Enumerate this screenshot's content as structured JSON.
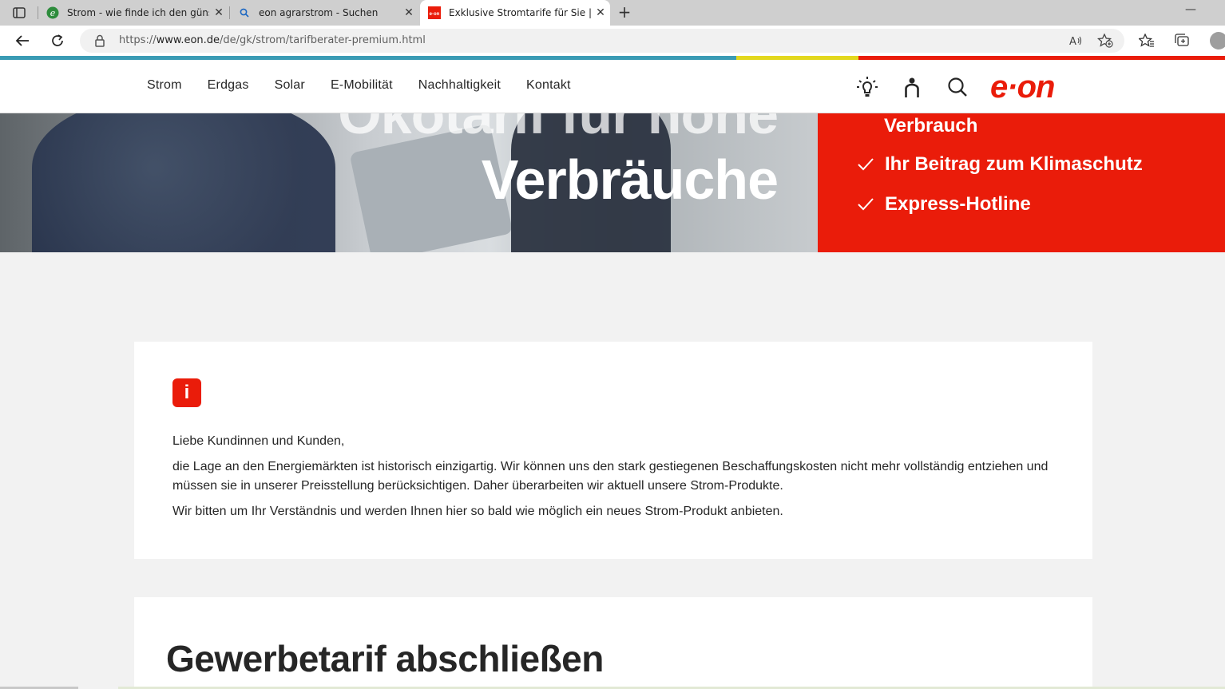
{
  "browser": {
    "tabs": [
      {
        "title": "Strom - wie finde ich den günstig",
        "favicon": "green-leaf-icon"
      },
      {
        "title": "eon agrarstrom - Suchen",
        "favicon": "search-icon"
      },
      {
        "title": "Exklusive Stromtarife für Sie | EO",
        "favicon": "eon-favicon",
        "active": true
      }
    ],
    "url_prefix": "https://",
    "url_host": "www.eon.de",
    "url_path": "/de/gk/strom/tarifberater-premium.html",
    "colors": {
      "strip_blue": "#3a9bb4",
      "strip_yellow": "#e3d81e",
      "strip_red": "#ea1c0a"
    }
  },
  "site": {
    "nav": [
      "Strom",
      "Erdgas",
      "Solar",
      "E-Mobilität",
      "Nachhaltigkeit",
      "Kontakt"
    ],
    "header_icons": [
      "lightbulb-icon",
      "person-icon",
      "search-icon"
    ],
    "logo": "e·on",
    "brand_red": "#ea1c0a"
  },
  "hero": {
    "title_line1": "Ökotarif für hohe",
    "title_line2": "Verbräuche",
    "benefits": [
      "Verbrauch",
      "Ihr Beitrag zum Klimaschutz",
      "Express-Hotline"
    ]
  },
  "notice": {
    "icon": "info-icon",
    "icon_label": "i",
    "greeting": "Liebe Kundinnen und Kunden,",
    "paragraph1": "die Lage an den Energiemärkten ist historisch einzigartig. Wir können uns den stark gestiegenen Beschaffungskosten nicht mehr vollständig entziehen und müssen sie in unserer Preisstellung berücksichtigen. Daher überarbeiten wir aktuell unsere Strom-Produkte.",
    "paragraph2": "Wir bitten um Ihr Verständnis und werden Ihnen hier so bald wie möglich ein neues Strom-Produkt anbieten."
  },
  "section": {
    "heading": "Gewerbetarif abschließen"
  }
}
